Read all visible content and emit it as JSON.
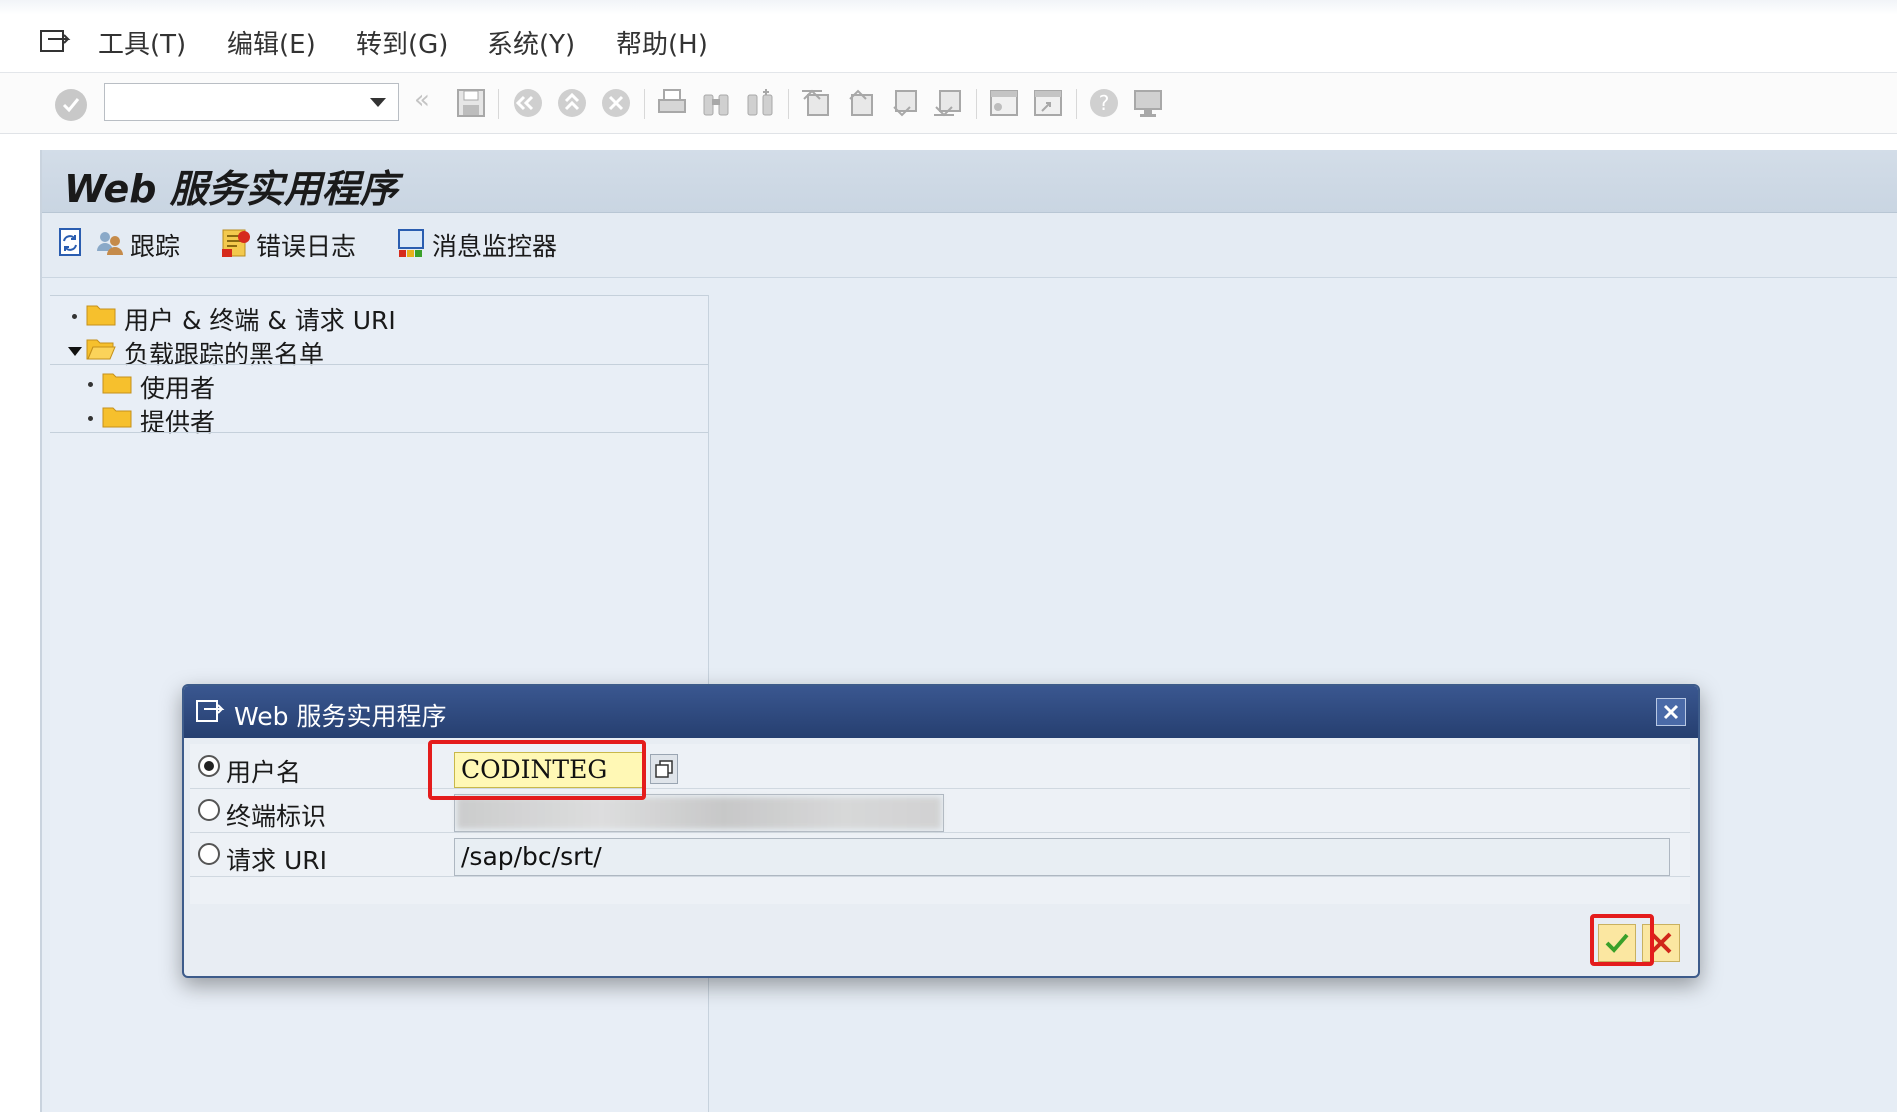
{
  "menubar": {
    "items": [
      "工具(T)",
      "编辑(E)",
      "转到(G)",
      "系统(Y)",
      "帮助(H)"
    ]
  },
  "toolbar": {
    "command_field_value": "",
    "icons": [
      "ok-icon",
      "back-double-icon",
      "save-icon",
      "back-icon",
      "exit-icon",
      "cancel-icon",
      "print-icon",
      "find-icon",
      "find-next-icon",
      "first-page-icon",
      "previous-page-icon",
      "next-page-icon",
      "last-page-icon",
      "create-session-icon",
      "shortcut-icon",
      "help-icon",
      "layout-icon"
    ]
  },
  "main": {
    "title": "Web 服务实用程序",
    "app_toolbar": {
      "trace_label": "跟踪",
      "error_log_label": "错误日志",
      "message_monitor_label": "消息监控器"
    },
    "tree": {
      "items": [
        {
          "label": "用户 & 终端 & 请求 URI",
          "expanded": false
        },
        {
          "label": "负载跟踪的黑名单",
          "expanded": true
        },
        {
          "label": "使用者",
          "expanded": false
        },
        {
          "label": "提供者",
          "expanded": false
        }
      ]
    }
  },
  "dialog": {
    "title": "Web 服务实用程序",
    "rows": [
      {
        "label": "用户名",
        "selected": true,
        "value": "CODINTEG"
      },
      {
        "label": "终端标识",
        "selected": false,
        "value": ""
      },
      {
        "label": "请求 URI",
        "selected": false,
        "value": "/sap/bc/srt/"
      }
    ]
  },
  "colors": {
    "dialog_header": "#2b4578",
    "highlight": "#e41c1c",
    "input_required": "#fff8b5",
    "ok_check": "#3aa02a",
    "cancel_x": "#d0261a"
  }
}
